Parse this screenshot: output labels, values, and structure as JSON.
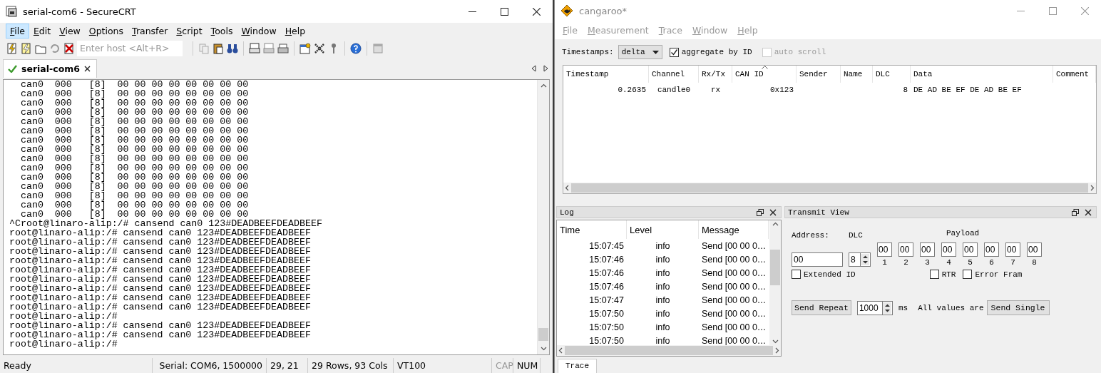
{
  "left_window": {
    "title": "serial-com6 - SecureCRT",
    "active": true,
    "menu": [
      {
        "label": "File",
        "selected": true
      },
      {
        "label": "Edit",
        "selected": false
      },
      {
        "label": "View",
        "selected": false
      },
      {
        "label": "Options",
        "selected": false
      },
      {
        "label": "Transfer",
        "selected": false
      },
      {
        "label": "Script",
        "selected": false
      },
      {
        "label": "Tools",
        "selected": false
      },
      {
        "label": "Window",
        "selected": false
      },
      {
        "label": "Help",
        "selected": false
      }
    ],
    "host_field": {
      "placeholder": "Enter host <Alt+R>"
    },
    "tabs": [
      {
        "label": "serial-com6",
        "selected": true
      }
    ],
    "terminal_lines": [
      "  can0  000   [8]  00 00 00 00 00 00 00 00",
      "  can0  000   [8]  00 00 00 00 00 00 00 00",
      "  can0  000   [8]  00 00 00 00 00 00 00 00",
      "  can0  000   [8]  00 00 00 00 00 00 00 00",
      "  can0  000   [8]  00 00 00 00 00 00 00 00",
      "  can0  000   [8]  00 00 00 00 00 00 00 00",
      "  can0  000   [8]  00 00 00 00 00 00 00 00",
      "  can0  000   [8]  00 00 00 00 00 00 00 00",
      "  can0  000   [8]  00 00 00 00 00 00 00 00",
      "  can0  000   [8]  00 00 00 00 00 00 00 00",
      "  can0  000   [8]  00 00 00 00 00 00 00 00",
      "  can0  000   [8]  00 00 00 00 00 00 00 00",
      "  can0  000   [8]  00 00 00 00 00 00 00 00",
      "  can0  000   [8]  00 00 00 00 00 00 00 00",
      "  can0  000   [8]  00 00 00 00 00 00 00 00",
      "^Croot@linaro-alip:/# cansend can0 123#DEADBEEFDEADBEEF",
      "root@linaro-alip:/# cansend can0 123#DEADBEEFDEADBEEF",
      "root@linaro-alip:/# cansend can0 123#DEADBEEFDEADBEEF",
      "root@linaro-alip:/# cansend can0 123#DEADBEEFDEADBEEF",
      "root@linaro-alip:/# cansend can0 123#DEADBEEFDEADBEEF",
      "root@linaro-alip:/# cansend can0 123#DEADBEEFDEADBEEF",
      "root@linaro-alip:/# cansend can0 123#DEADBEEFDEADBEEF",
      "root@linaro-alip:/# cansend can0 123#DEADBEEFDEADBEEF",
      "root@linaro-alip:/# cansend can0 123#DEADBEEFDEADBEEF",
      "root@linaro-alip:/# cansend can0 123#DEADBEEFDEADBEEF",
      "root@linaro-alip:/#",
      "root@linaro-alip:/# cansend can0 123#DEADBEEFDEADBEEF",
      "root@linaro-alip:/# cansend can0 123#DEADBEEFDEADBEEF",
      "root@linaro-alip:/#"
    ],
    "status_bar": [
      {
        "text": "Ready",
        "disabled": false
      },
      {
        "text": "Serial: COM6, 1500000",
        "disabled": false
      },
      {
        "text": "29,  21",
        "disabled": false
      },
      {
        "text": "29 Rows, 93 Cols",
        "disabled": false
      },
      {
        "text": "VT100",
        "disabled": false
      },
      {
        "text": "CAP",
        "disabled": true
      },
      {
        "text": "NUM",
        "disabled": false
      }
    ]
  },
  "right_window": {
    "title": "cangaroo*",
    "active": false,
    "menu": [
      "File",
      "Measurement",
      "Trace",
      "Window",
      "Help"
    ],
    "timestamps": {
      "label": "Timestamps:",
      "value": "delta"
    },
    "options": [
      {
        "label": "aggregate by ID",
        "checked": true,
        "disabled": false
      },
      {
        "label": "auto scroll",
        "checked": false,
        "disabled": true
      }
    ],
    "trace": {
      "columns": [
        {
          "label": "Timestamp",
          "sorted": false
        },
        {
          "label": "Channel",
          "sorted": false
        },
        {
          "label": "Rx/Tx",
          "sorted": false
        },
        {
          "label": "CAN ID",
          "sorted": true
        },
        {
          "label": "Sender",
          "sorted": false
        },
        {
          "label": "Name",
          "sorted": false
        },
        {
          "label": "DLC",
          "sorted": false
        },
        {
          "label": "Data",
          "sorted": false
        },
        {
          "label": "Comment",
          "sorted": false
        }
      ],
      "rows": [
        {
          "timestamp": "0.2635",
          "channel": "candle0",
          "rx_tx": "rx",
          "can_id": "0x123",
          "dlc": "8",
          "data": "DE AD BE EF DE AD BE EF"
        }
      ]
    },
    "log": {
      "title": "Log",
      "columns": [
        "Time",
        "Level",
        "Message"
      ],
      "rows": [
        {
          "time": "15:07:45",
          "level": "info",
          "message": "Send [00 00 0…"
        },
        {
          "time": "15:07:46",
          "level": "info",
          "message": "Send [00 00 0…"
        },
        {
          "time": "15:07:46",
          "level": "info",
          "message": "Send [00 00 0…"
        },
        {
          "time": "15:07:46",
          "level": "info",
          "message": "Send [00 00 0…"
        },
        {
          "time": "15:07:47",
          "level": "info",
          "message": "Send [00 00 0…"
        },
        {
          "time": "15:07:50",
          "level": "info",
          "message": "Send [00 00 0…"
        },
        {
          "time": "15:07:50",
          "level": "info",
          "message": "Send [00 00 0…"
        },
        {
          "time": "15:07:50",
          "level": "info",
          "message": "Send [00 00 0…"
        }
      ]
    },
    "transmit": {
      "title": "Transmit View",
      "address_label": "Address:",
      "address": "00",
      "dlc_label": "DLC",
      "dlc": "8",
      "payload_label": "Payload",
      "payload": [
        {
          "value": "00",
          "index": "1"
        },
        {
          "value": "00",
          "index": "2"
        },
        {
          "value": "00",
          "index": "3"
        },
        {
          "value": "00",
          "index": "4"
        },
        {
          "value": "00",
          "index": "5"
        },
        {
          "value": "00",
          "index": "6"
        },
        {
          "value": "00",
          "index": "7"
        },
        {
          "value": "00",
          "index": "8"
        }
      ],
      "flags": [
        {
          "label": "Extended ID",
          "checked": false
        },
        {
          "label": "RTR",
          "checked": false
        },
        {
          "label": "Error Fram",
          "checked": false
        }
      ],
      "send_repeat": "Send Repeat",
      "interval": "1000",
      "interval_unit": "ms",
      "note": "All values are",
      "send_single": "Send Single"
    },
    "bottom_tabs": [
      {
        "label": "Trace",
        "selected": true
      }
    ]
  }
}
